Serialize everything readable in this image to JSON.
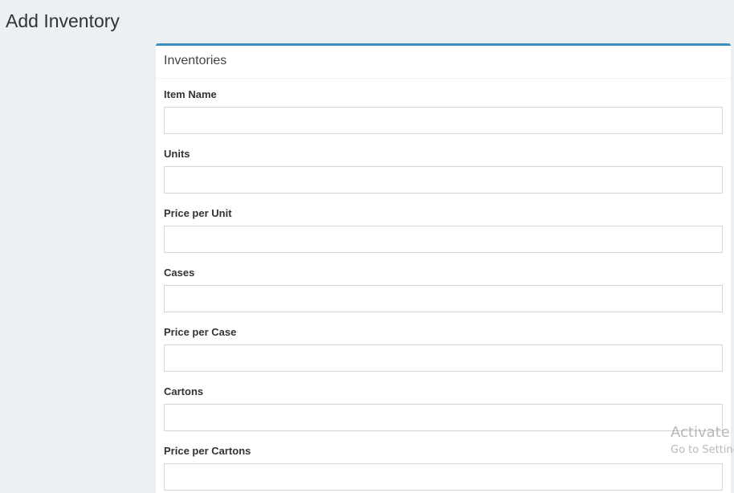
{
  "page": {
    "title": "Add Inventory"
  },
  "box": {
    "title": "Inventories",
    "accent_color": "#3c8dbc"
  },
  "form": {
    "fields": [
      {
        "label": "Item Name",
        "value": "",
        "placeholder": ""
      },
      {
        "label": "Units",
        "value": "",
        "placeholder": ""
      },
      {
        "label": "Price per Unit",
        "value": "",
        "placeholder": ""
      },
      {
        "label": "Cases",
        "value": "",
        "placeholder": ""
      },
      {
        "label": "Price per Case",
        "value": "",
        "placeholder": ""
      },
      {
        "label": "Cartons",
        "value": "",
        "placeholder": ""
      },
      {
        "label": "Price per Cartons",
        "value": "",
        "placeholder": ""
      }
    ]
  },
  "watermark": {
    "line1": "Activate Windows",
    "line2": "Go to Settings to activate Windows."
  }
}
